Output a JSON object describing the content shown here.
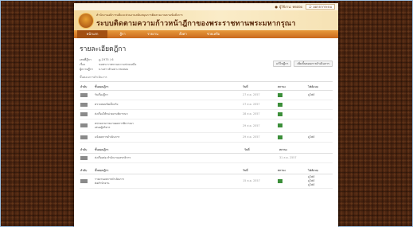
{
  "topbar": {
    "user_text": "ผู้ใช้งาน: ทดสอบ",
    "logout_label": "ออกจากระบบ"
  },
  "banner": {
    "subtitle": "สำนักงานอธิการบดีและส่วนงานสนับสนุนการติดตามงานตามข้อสั่งการ",
    "title": "ระบบติดตามความก้าวหน้าฎีกาของพระราชทานพระมหากรุณา"
  },
  "nav": {
    "items": [
      "หน้าแรก",
      "ฎีกา",
      "รายงาน",
      "ตั้งค่า",
      "ช่วยเหลือ"
    ]
  },
  "content": {
    "page_title": "รายละเอียดฎีกา",
    "info": [
      {
        "label": "เลขที่ฎีกา",
        "value": "ฎ.1975 / 6"
      },
      {
        "label": "เรื่อง",
        "value": "ขอพระราชทานความช่วยเหลือ"
      },
      {
        "label": "ผู้ถวายฎีกา",
        "value": "นางสาวตัวอย่าง ทดสอบ"
      }
    ],
    "buttons": {
      "edit": "แก้ไขฎีกา",
      "add_step": "เพิ่มขั้นตอนการดำเนินการ"
    },
    "section1": {
      "label": "ขั้นตอนการดำเนินการ",
      "headers": [
        "ลำดับ",
        "ขั้นตอนฎีกา",
        "วันที่",
        "สถานะ",
        "ไฟล์แนบ"
      ],
      "rows": [
        {
          "step": "รับเรื่องฎีกา",
          "date": "27 ส.ค. 2557",
          "file": "ดูไฟล์"
        },
        {
          "step": "ตรวจสอบข้อเท็จจริง",
          "date": "27 ส.ค. 2557",
          "file": ""
        },
        {
          "step": "ส่งเรื่องให้หน่วยงานพิจารณา",
          "date": "28 ส.ค. 2557",
          "file": ""
        },
        {
          "step": "หน่วยงานรายงานผลการพิจารณา",
          "step2": "เสนอผู้บริหาร",
          "date": "29 ส.ค. 2557",
          "file": ""
        },
        {
          "step": "แจ้งผลการดำเนินการ",
          "date": "29 ส.ค. 2557",
          "file": "ดูไฟล์"
        }
      ]
    },
    "section2": {
      "headers": [
        "ลำดับ",
        "ขั้นตอนฎีกา",
        "วันที่",
        "สถานะ"
      ],
      "rows": [
        {
          "step": "ส่งเรื่องต่อ สำนักงานเลขาธิการ",
          "date": "31 ส.ค. 2557"
        }
      ]
    },
    "section3": {
      "headers": [
        "ลำดับ",
        "ขั้นตอนฎีกา",
        "วันที่",
        "สถานะ",
        "ไฟล์แนบ"
      ],
      "rows": [
        {
          "step": "รายงานผลการดำเนินการ",
          "step2": "ต่อสำนักงาน",
          "date": "15 ต.ค. 2557",
          "files": [
            "ดูไฟล์",
            "ดูไฟล์",
            "ดูไฟล์"
          ]
        }
      ]
    }
  },
  "colors": {
    "nav_orange": "#d9822b",
    "status_green": "#3c8f3a",
    "brown_bg": "#4a2410"
  }
}
